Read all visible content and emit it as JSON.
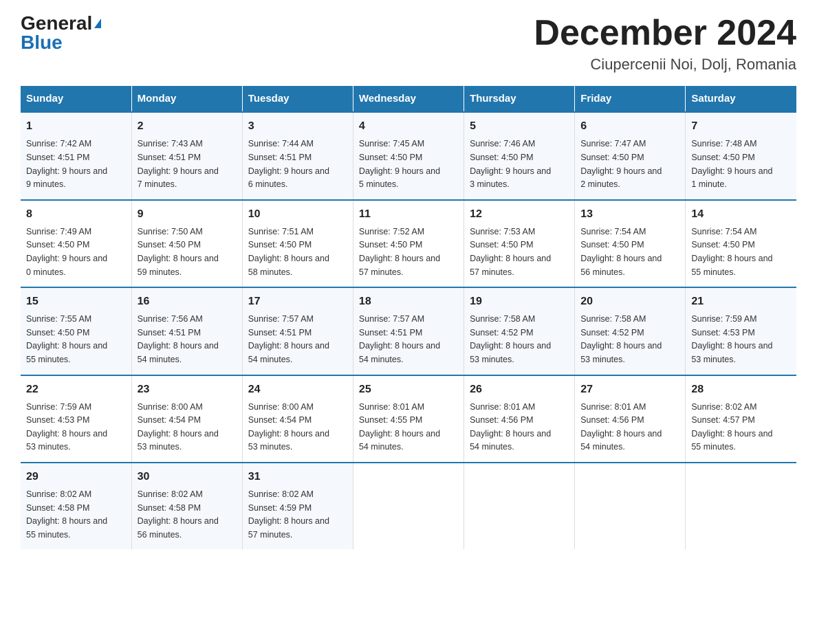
{
  "header": {
    "logo": {
      "general": "General",
      "triangle": "▶",
      "blue": "Blue"
    },
    "title": "December 2024",
    "subtitle": "Ciupercenii Noi, Dolj, Romania"
  },
  "days_of_week": [
    "Sunday",
    "Monday",
    "Tuesday",
    "Wednesday",
    "Thursday",
    "Friday",
    "Saturday"
  ],
  "weeks": [
    [
      {
        "day": "1",
        "sunrise": "7:42 AM",
        "sunset": "4:51 PM",
        "daylight": "9 hours and 9 minutes."
      },
      {
        "day": "2",
        "sunrise": "7:43 AM",
        "sunset": "4:51 PM",
        "daylight": "9 hours and 7 minutes."
      },
      {
        "day": "3",
        "sunrise": "7:44 AM",
        "sunset": "4:51 PM",
        "daylight": "9 hours and 6 minutes."
      },
      {
        "day": "4",
        "sunrise": "7:45 AM",
        "sunset": "4:50 PM",
        "daylight": "9 hours and 5 minutes."
      },
      {
        "day": "5",
        "sunrise": "7:46 AM",
        "sunset": "4:50 PM",
        "daylight": "9 hours and 3 minutes."
      },
      {
        "day": "6",
        "sunrise": "7:47 AM",
        "sunset": "4:50 PM",
        "daylight": "9 hours and 2 minutes."
      },
      {
        "day": "7",
        "sunrise": "7:48 AM",
        "sunset": "4:50 PM",
        "daylight": "9 hours and 1 minute."
      }
    ],
    [
      {
        "day": "8",
        "sunrise": "7:49 AM",
        "sunset": "4:50 PM",
        "daylight": "9 hours and 0 minutes."
      },
      {
        "day": "9",
        "sunrise": "7:50 AM",
        "sunset": "4:50 PM",
        "daylight": "8 hours and 59 minutes."
      },
      {
        "day": "10",
        "sunrise": "7:51 AM",
        "sunset": "4:50 PM",
        "daylight": "8 hours and 58 minutes."
      },
      {
        "day": "11",
        "sunrise": "7:52 AM",
        "sunset": "4:50 PM",
        "daylight": "8 hours and 57 minutes."
      },
      {
        "day": "12",
        "sunrise": "7:53 AM",
        "sunset": "4:50 PM",
        "daylight": "8 hours and 57 minutes."
      },
      {
        "day": "13",
        "sunrise": "7:54 AM",
        "sunset": "4:50 PM",
        "daylight": "8 hours and 56 minutes."
      },
      {
        "day": "14",
        "sunrise": "7:54 AM",
        "sunset": "4:50 PM",
        "daylight": "8 hours and 55 minutes."
      }
    ],
    [
      {
        "day": "15",
        "sunrise": "7:55 AM",
        "sunset": "4:50 PM",
        "daylight": "8 hours and 55 minutes."
      },
      {
        "day": "16",
        "sunrise": "7:56 AM",
        "sunset": "4:51 PM",
        "daylight": "8 hours and 54 minutes."
      },
      {
        "day": "17",
        "sunrise": "7:57 AM",
        "sunset": "4:51 PM",
        "daylight": "8 hours and 54 minutes."
      },
      {
        "day": "18",
        "sunrise": "7:57 AM",
        "sunset": "4:51 PM",
        "daylight": "8 hours and 54 minutes."
      },
      {
        "day": "19",
        "sunrise": "7:58 AM",
        "sunset": "4:52 PM",
        "daylight": "8 hours and 53 minutes."
      },
      {
        "day": "20",
        "sunrise": "7:58 AM",
        "sunset": "4:52 PM",
        "daylight": "8 hours and 53 minutes."
      },
      {
        "day": "21",
        "sunrise": "7:59 AM",
        "sunset": "4:53 PM",
        "daylight": "8 hours and 53 minutes."
      }
    ],
    [
      {
        "day": "22",
        "sunrise": "7:59 AM",
        "sunset": "4:53 PM",
        "daylight": "8 hours and 53 minutes."
      },
      {
        "day": "23",
        "sunrise": "8:00 AM",
        "sunset": "4:54 PM",
        "daylight": "8 hours and 53 minutes."
      },
      {
        "day": "24",
        "sunrise": "8:00 AM",
        "sunset": "4:54 PM",
        "daylight": "8 hours and 53 minutes."
      },
      {
        "day": "25",
        "sunrise": "8:01 AM",
        "sunset": "4:55 PM",
        "daylight": "8 hours and 54 minutes."
      },
      {
        "day": "26",
        "sunrise": "8:01 AM",
        "sunset": "4:56 PM",
        "daylight": "8 hours and 54 minutes."
      },
      {
        "day": "27",
        "sunrise": "8:01 AM",
        "sunset": "4:56 PM",
        "daylight": "8 hours and 54 minutes."
      },
      {
        "day": "28",
        "sunrise": "8:02 AM",
        "sunset": "4:57 PM",
        "daylight": "8 hours and 55 minutes."
      }
    ],
    [
      {
        "day": "29",
        "sunrise": "8:02 AM",
        "sunset": "4:58 PM",
        "daylight": "8 hours and 55 minutes."
      },
      {
        "day": "30",
        "sunrise": "8:02 AM",
        "sunset": "4:58 PM",
        "daylight": "8 hours and 56 minutes."
      },
      {
        "day": "31",
        "sunrise": "8:02 AM",
        "sunset": "4:59 PM",
        "daylight": "8 hours and 57 minutes."
      },
      null,
      null,
      null,
      null
    ]
  ],
  "labels": {
    "sunrise": "Sunrise:",
    "sunset": "Sunset:",
    "daylight": "Daylight:"
  }
}
